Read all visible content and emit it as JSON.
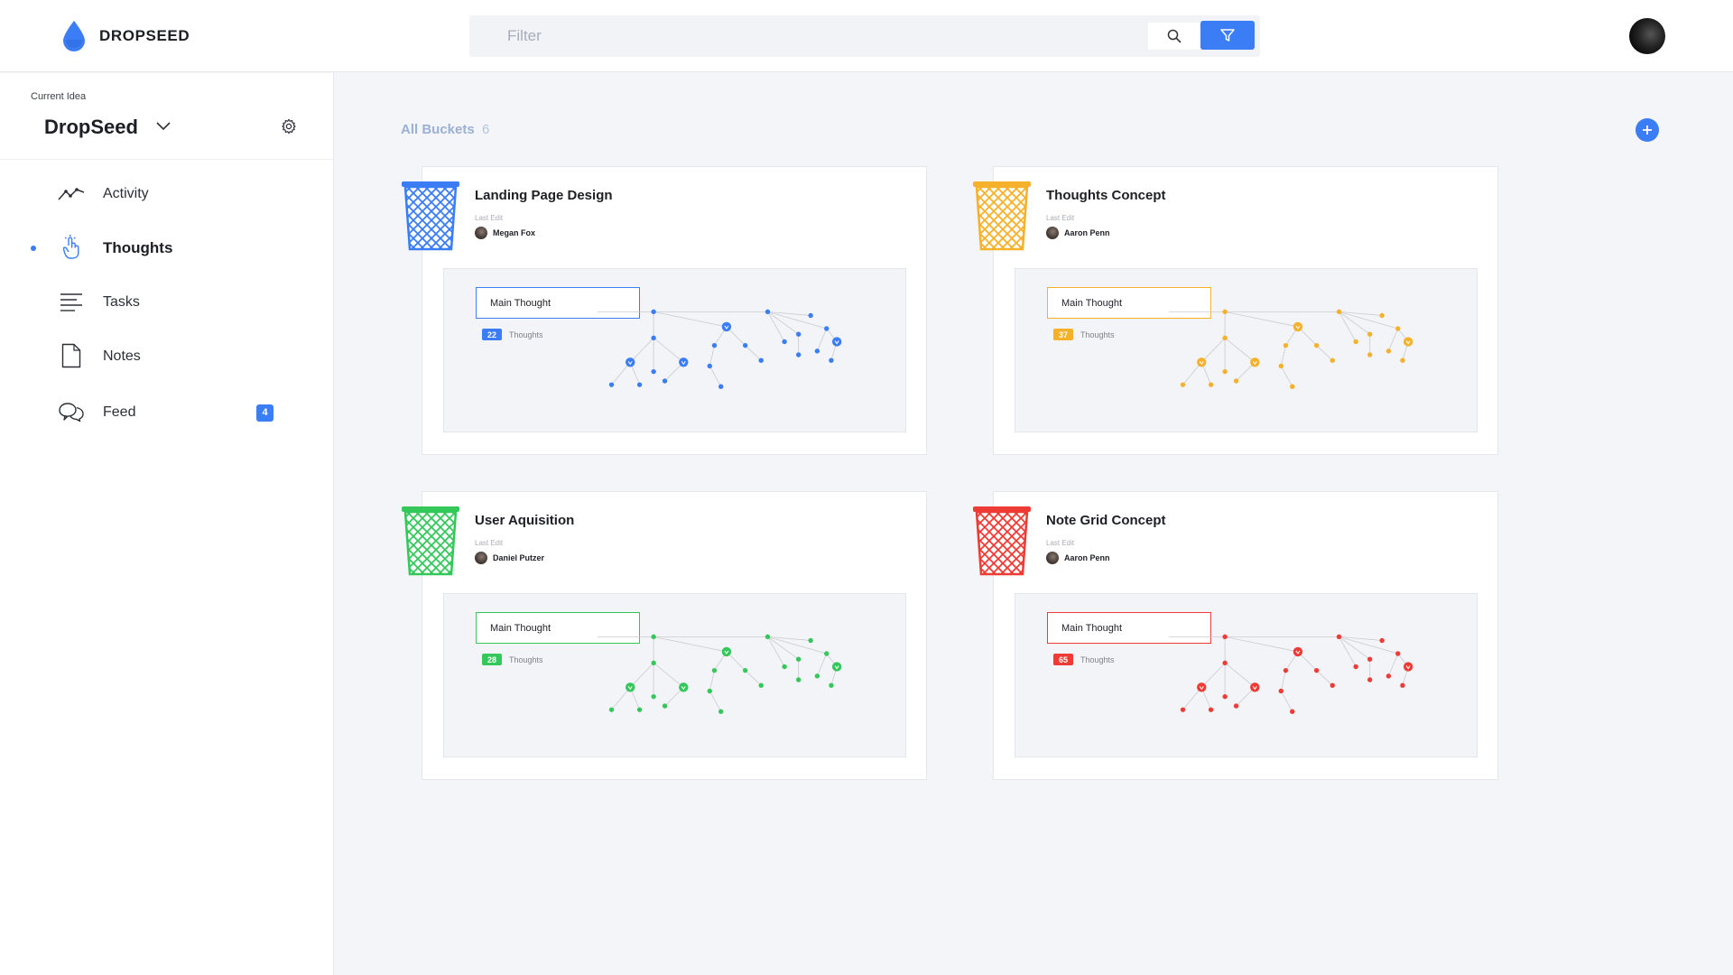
{
  "app": {
    "name": "DROPSEED",
    "brand_color": "#3a7df4"
  },
  "search": {
    "placeholder": "Filter",
    "value": ""
  },
  "sidebar": {
    "current_idea_label": "Current Idea",
    "idea_name": "DropSeed",
    "nav": [
      {
        "label": "Activity",
        "icon": "activity-icon",
        "active": false
      },
      {
        "label": "Thoughts",
        "icon": "touch-icon",
        "active": true
      },
      {
        "label": "Tasks",
        "icon": "tasks-icon",
        "active": false
      },
      {
        "label": "Notes",
        "icon": "notes-icon",
        "active": false
      },
      {
        "label": "Feed",
        "icon": "feed-icon",
        "active": false,
        "badge": "4"
      }
    ]
  },
  "main": {
    "section_title": "All Buckets",
    "section_count": "6",
    "buckets": [
      {
        "title": "Landing Page Design",
        "last_edit_label": "Last Edit",
        "editor": "Megan Fox",
        "main_thought": "Main Thought",
        "count": "22",
        "count_label": "Thoughts",
        "color": "#3a7df4"
      },
      {
        "title": "Thoughts Concept",
        "last_edit_label": "Last Edit",
        "editor": "Aaron Penn",
        "main_thought": "Main Thought",
        "count": "37",
        "count_label": "Thoughts",
        "color": "#f6b12a"
      },
      {
        "title": "User Aquisition",
        "last_edit_label": "Last Edit",
        "editor": "Daniel Putzer",
        "main_thought": "Main Thought",
        "count": "28",
        "count_label": "Thoughts",
        "color": "#34c85a"
      },
      {
        "title": "Note Grid Concept",
        "last_edit_label": "Last Edit",
        "editor": "Aaron Penn",
        "main_thought": "Main Thought",
        "count": "65",
        "count_label": "Thoughts",
        "color": "#ef3b35"
      }
    ]
  }
}
